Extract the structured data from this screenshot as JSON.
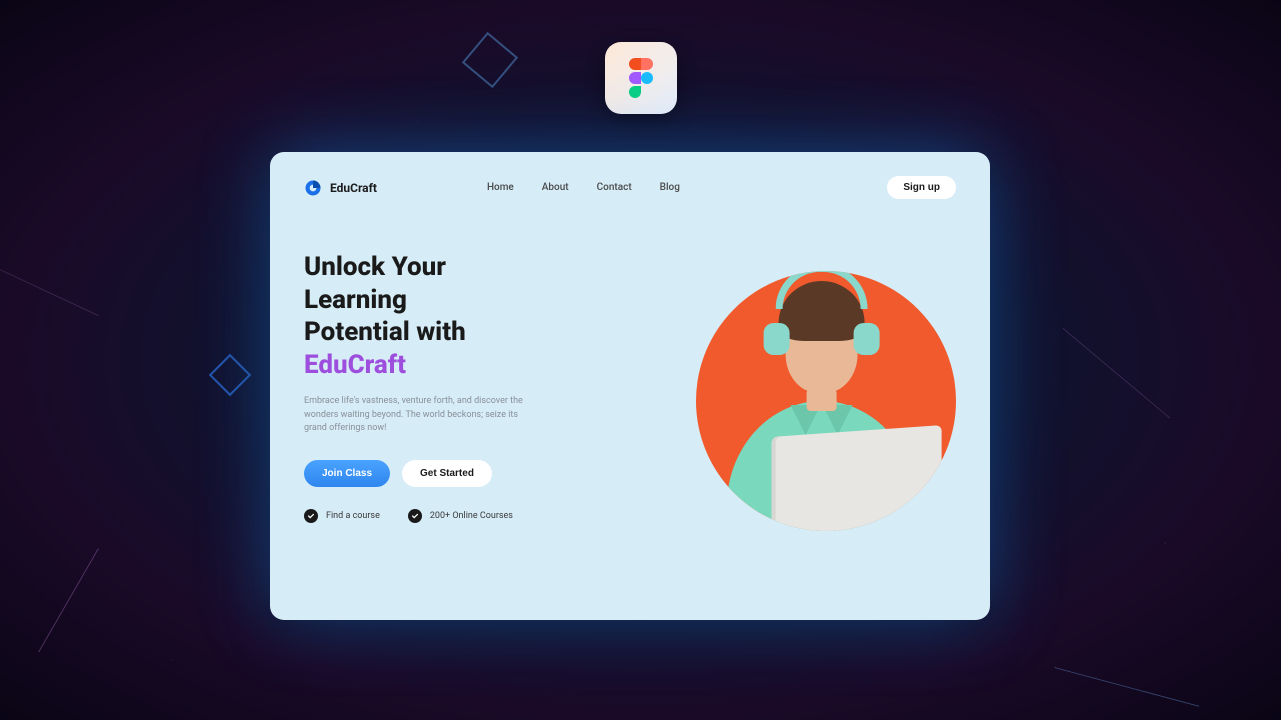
{
  "brand": {
    "name": "EduCraft"
  },
  "nav": {
    "items": [
      "Home",
      "About",
      "Contact",
      "Blog"
    ],
    "signup_label": "Sign up"
  },
  "hero": {
    "headline_line1": "Unlock Your",
    "headline_line2": "Learning",
    "headline_line3": "Potential with",
    "headline_brand": "EduCraft",
    "subheading": "Embrace life's vastness, venture forth, and discover the wonders waiting beyond. The world beckons; seize its grand offerings now!",
    "cta_primary": "Join Class",
    "cta_secondary": "Get Started",
    "features": [
      "Find a course",
      "200+ Online Courses"
    ]
  },
  "colors": {
    "accent_purple": "#9d4edd",
    "accent_blue": "#2f86ef",
    "hero_circle": "#f15a2c",
    "card_bg": "#d6ecf7"
  }
}
